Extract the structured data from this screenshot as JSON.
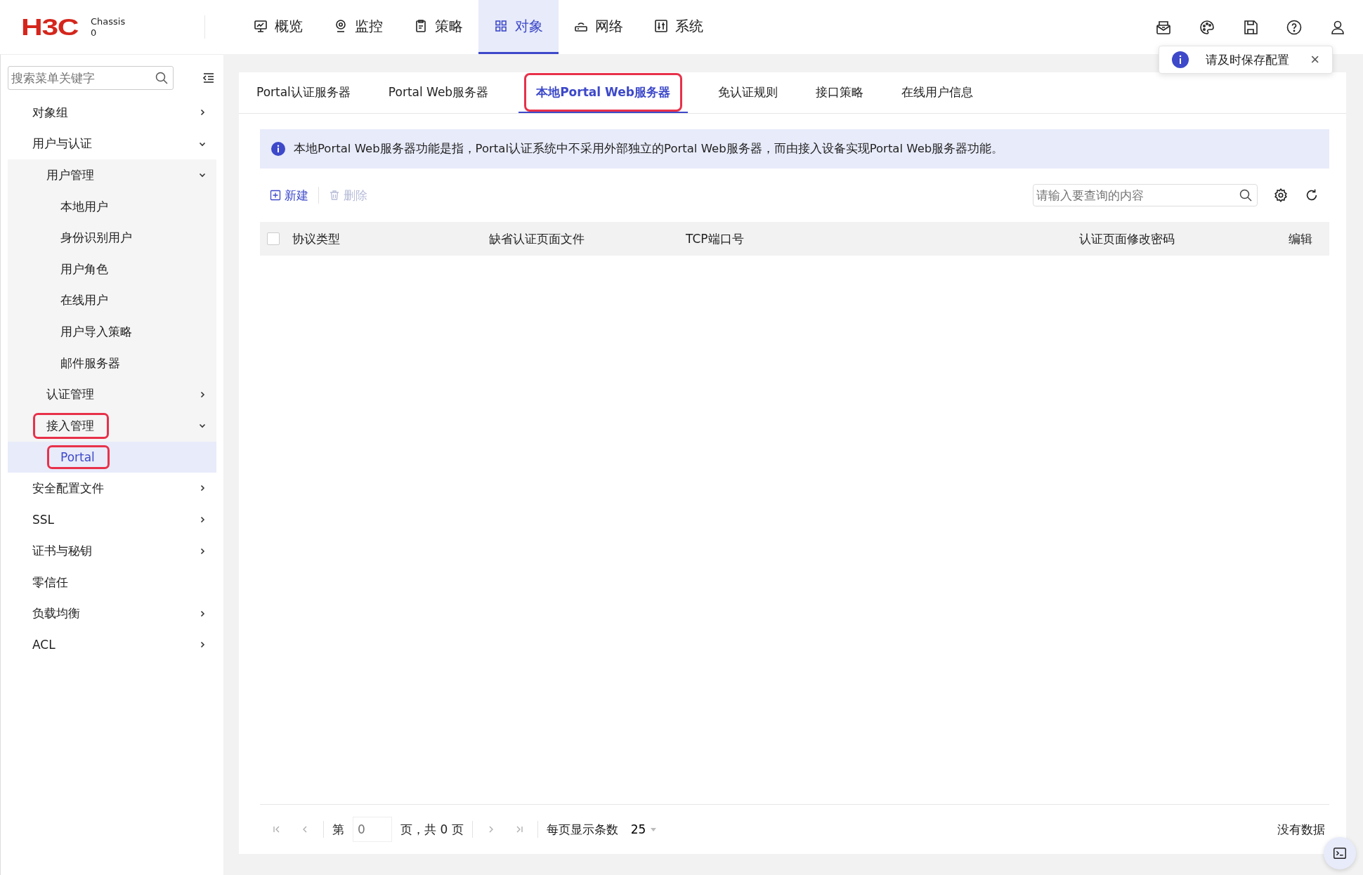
{
  "header": {
    "logo": "H3C",
    "device_name": "Chassis",
    "device_id": "0",
    "nav": [
      {
        "label": "概览",
        "selected": false
      },
      {
        "label": "监控",
        "selected": false
      },
      {
        "label": "策略",
        "selected": false
      },
      {
        "label": "对象",
        "selected": true
      },
      {
        "label": "网络",
        "selected": false
      },
      {
        "label": "系统",
        "selected": false
      }
    ],
    "toast": {
      "text": "请及时保存配置",
      "close": "×"
    }
  },
  "sidebar": {
    "search": {
      "placeholder": "搜索菜单关键字"
    },
    "items": [
      {
        "label": "对象组",
        "expanded": false,
        "selected": false,
        "highlighted": false
      },
      {
        "label": "用户与认证",
        "expanded": true,
        "selected": false,
        "highlighted": false,
        "children": [
          {
            "label": "用户管理",
            "expanded": true,
            "selected": false,
            "highlighted": false,
            "children": [
              {
                "label": "本地用户",
                "selected": false,
                "highlighted": false
              },
              {
                "label": "身份识别用户",
                "selected": false,
                "highlighted": false
              },
              {
                "label": "用户角色",
                "selected": false,
                "highlighted": false
              },
              {
                "label": "在线用户",
                "selected": false,
                "highlighted": false
              },
              {
                "label": "用户导入策略",
                "selected": false,
                "highlighted": false
              },
              {
                "label": "邮件服务器",
                "selected": false,
                "highlighted": false
              }
            ]
          },
          {
            "label": "认证管理",
            "expanded": false,
            "selected": false,
            "highlighted": false
          },
          {
            "label": "接入管理",
            "expanded": true,
            "selected": false,
            "highlighted": true,
            "children": [
              {
                "label": "Portal",
                "selected": true,
                "highlighted": true
              }
            ]
          }
        ]
      },
      {
        "label": "安全配置文件",
        "expanded": false,
        "selected": false,
        "highlighted": false
      },
      {
        "label": "SSL",
        "expanded": false,
        "selected": false,
        "highlighted": false
      },
      {
        "label": "证书与秘钥",
        "expanded": false,
        "selected": false,
        "highlighted": false
      },
      {
        "label": "零信任",
        "selected": false,
        "highlighted": false
      },
      {
        "label": "负载均衡",
        "expanded": false,
        "selected": false,
        "highlighted": false
      },
      {
        "label": "ACL",
        "expanded": false,
        "selected": false,
        "highlighted": false
      }
    ]
  },
  "tabs": [
    {
      "label": "Portal认证服务器",
      "selected": false,
      "highlighted": false
    },
    {
      "label": "Portal Web服务器",
      "selected": false,
      "highlighted": false
    },
    {
      "label": "本地Portal Web服务器",
      "selected": true,
      "highlighted": true
    },
    {
      "label": "免认证规则",
      "selected": false,
      "highlighted": false
    },
    {
      "label": "接口策略",
      "selected": false,
      "highlighted": false
    },
    {
      "label": "在线用户信息",
      "selected": false,
      "highlighted": false
    }
  ],
  "info": "本地Portal Web服务器功能是指，Portal认证系统中不采用外部独立的Portal Web服务器，而由接入设备实现Portal Web服务器功能。",
  "toolbar": {
    "buttons": [
      {
        "label": "新建",
        "disabled": false
      },
      {
        "label": "删除",
        "disabled": true
      }
    ],
    "search": {
      "placeholder": "请输入要查询的内容"
    }
  },
  "table": {
    "select_all": {
      "checked": false
    },
    "columns": [
      "协议类型",
      "缺省认证页面文件",
      "TCP端口号",
      "认证页面修改密码",
      "编辑"
    ]
  },
  "pagination": {
    "page_prefix": "第",
    "page_placeholder": "0",
    "page_suffix": "页，共 0 页",
    "page_size_label": "每页显示条数",
    "page_size": "25",
    "status": "没有数据"
  }
}
